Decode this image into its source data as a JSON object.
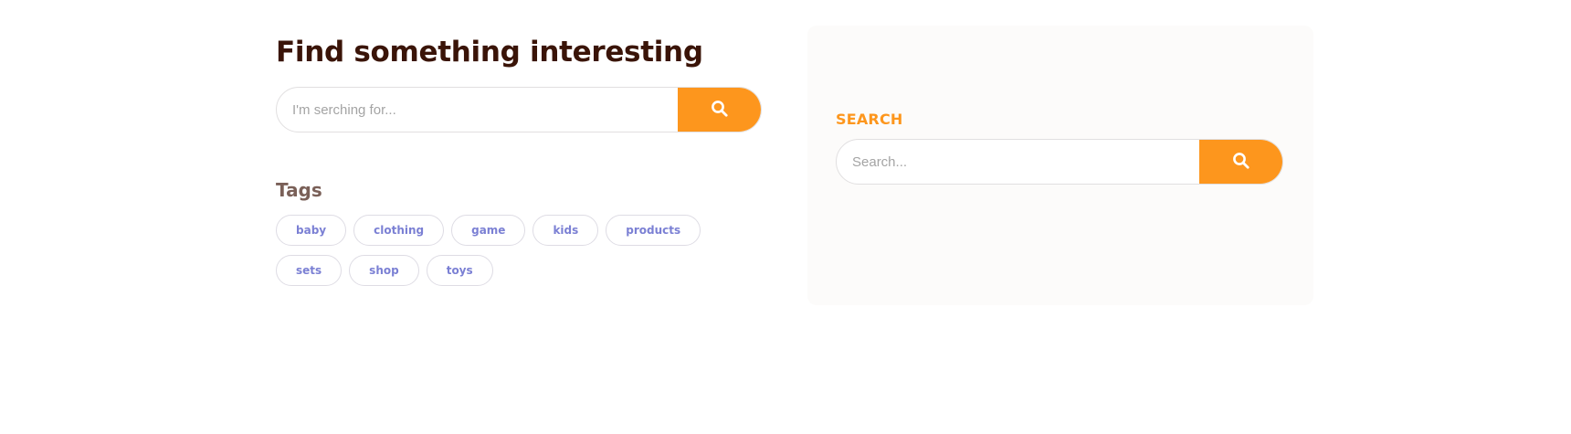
{
  "main": {
    "title": "Find something interesting",
    "search": {
      "placeholder": "I'm serching for...",
      "value": ""
    },
    "tags_title": "Tags",
    "tags": [
      "baby",
      "clothing",
      "game",
      "kids",
      "products",
      "sets",
      "shop",
      "toys"
    ]
  },
  "sidebar_widget": {
    "title": "SEARCH",
    "search": {
      "placeholder": "Search...",
      "value": ""
    }
  },
  "colors": {
    "accent": "#fd961d",
    "title": "#3a1408",
    "tag_text": "#7b80d4",
    "tags_heading": "#7a6058",
    "widget_bg": "#fcfbfa"
  },
  "icons": {
    "search_button": "search-icon"
  }
}
